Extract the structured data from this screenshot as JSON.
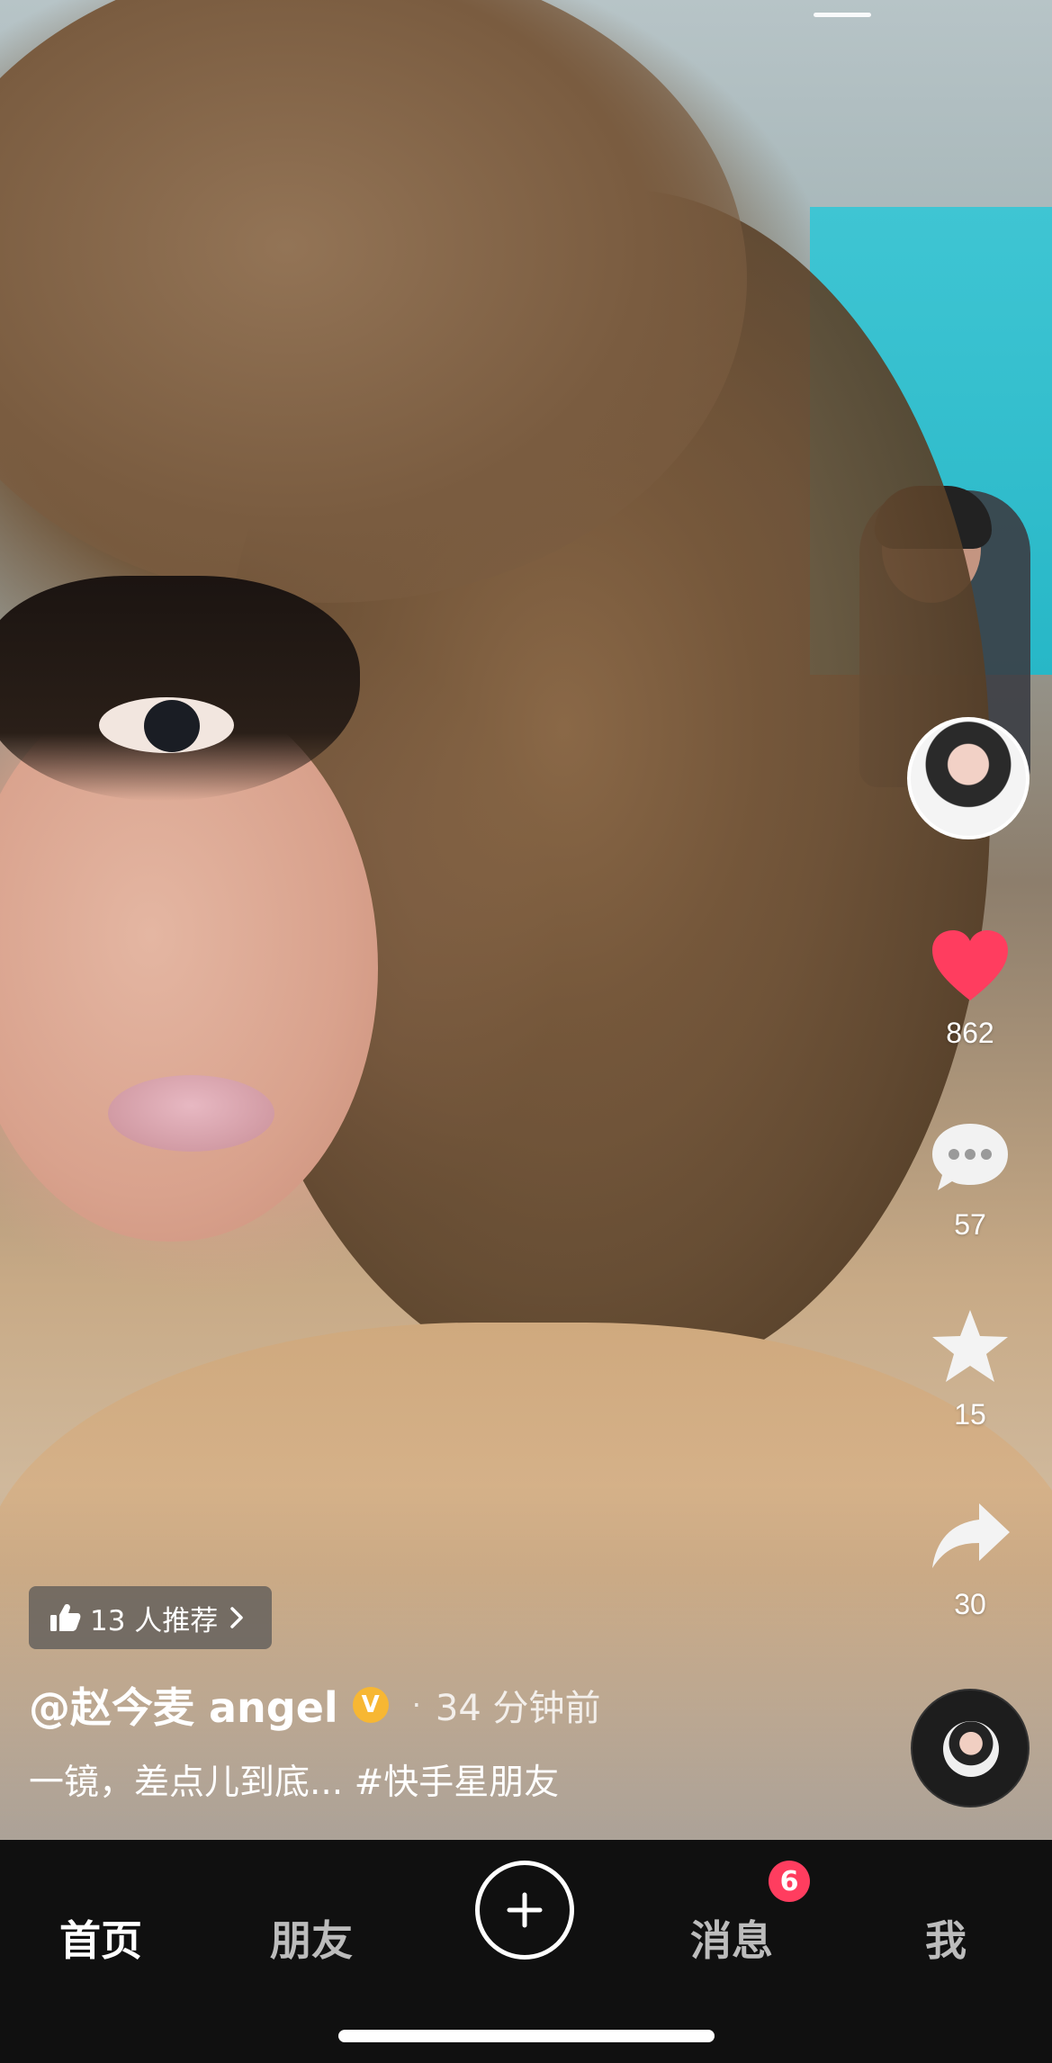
{
  "video": {
    "recommend_label": "13 人推荐",
    "author": "@赵今麦 angel",
    "verified_label": "V",
    "separator": "·",
    "time_ago": "34 分钟前",
    "caption": "一镜，差点儿到底... #快手星朋友"
  },
  "actions": {
    "likes": "862",
    "comments": "57",
    "favorites": "15",
    "shares": "30"
  },
  "tabs": [
    {
      "label": "首页",
      "active": true
    },
    {
      "label": "朋友",
      "active": false
    },
    {
      "label": "消息",
      "active": false
    },
    {
      "label": "我",
      "active": false
    }
  ],
  "messages_badge": "6",
  "icons": {
    "like": "heart-icon",
    "comment": "comment-icon",
    "favorite": "star-icon",
    "share": "share-icon",
    "recommend": "thumb-up-icon",
    "chevron": "chevron-right-icon",
    "create": "plus-icon"
  },
  "colors": {
    "like": "#ff3d5f",
    "badge": "#ff3d5f",
    "verified": "#f7b733",
    "tabbar": "#101010"
  }
}
